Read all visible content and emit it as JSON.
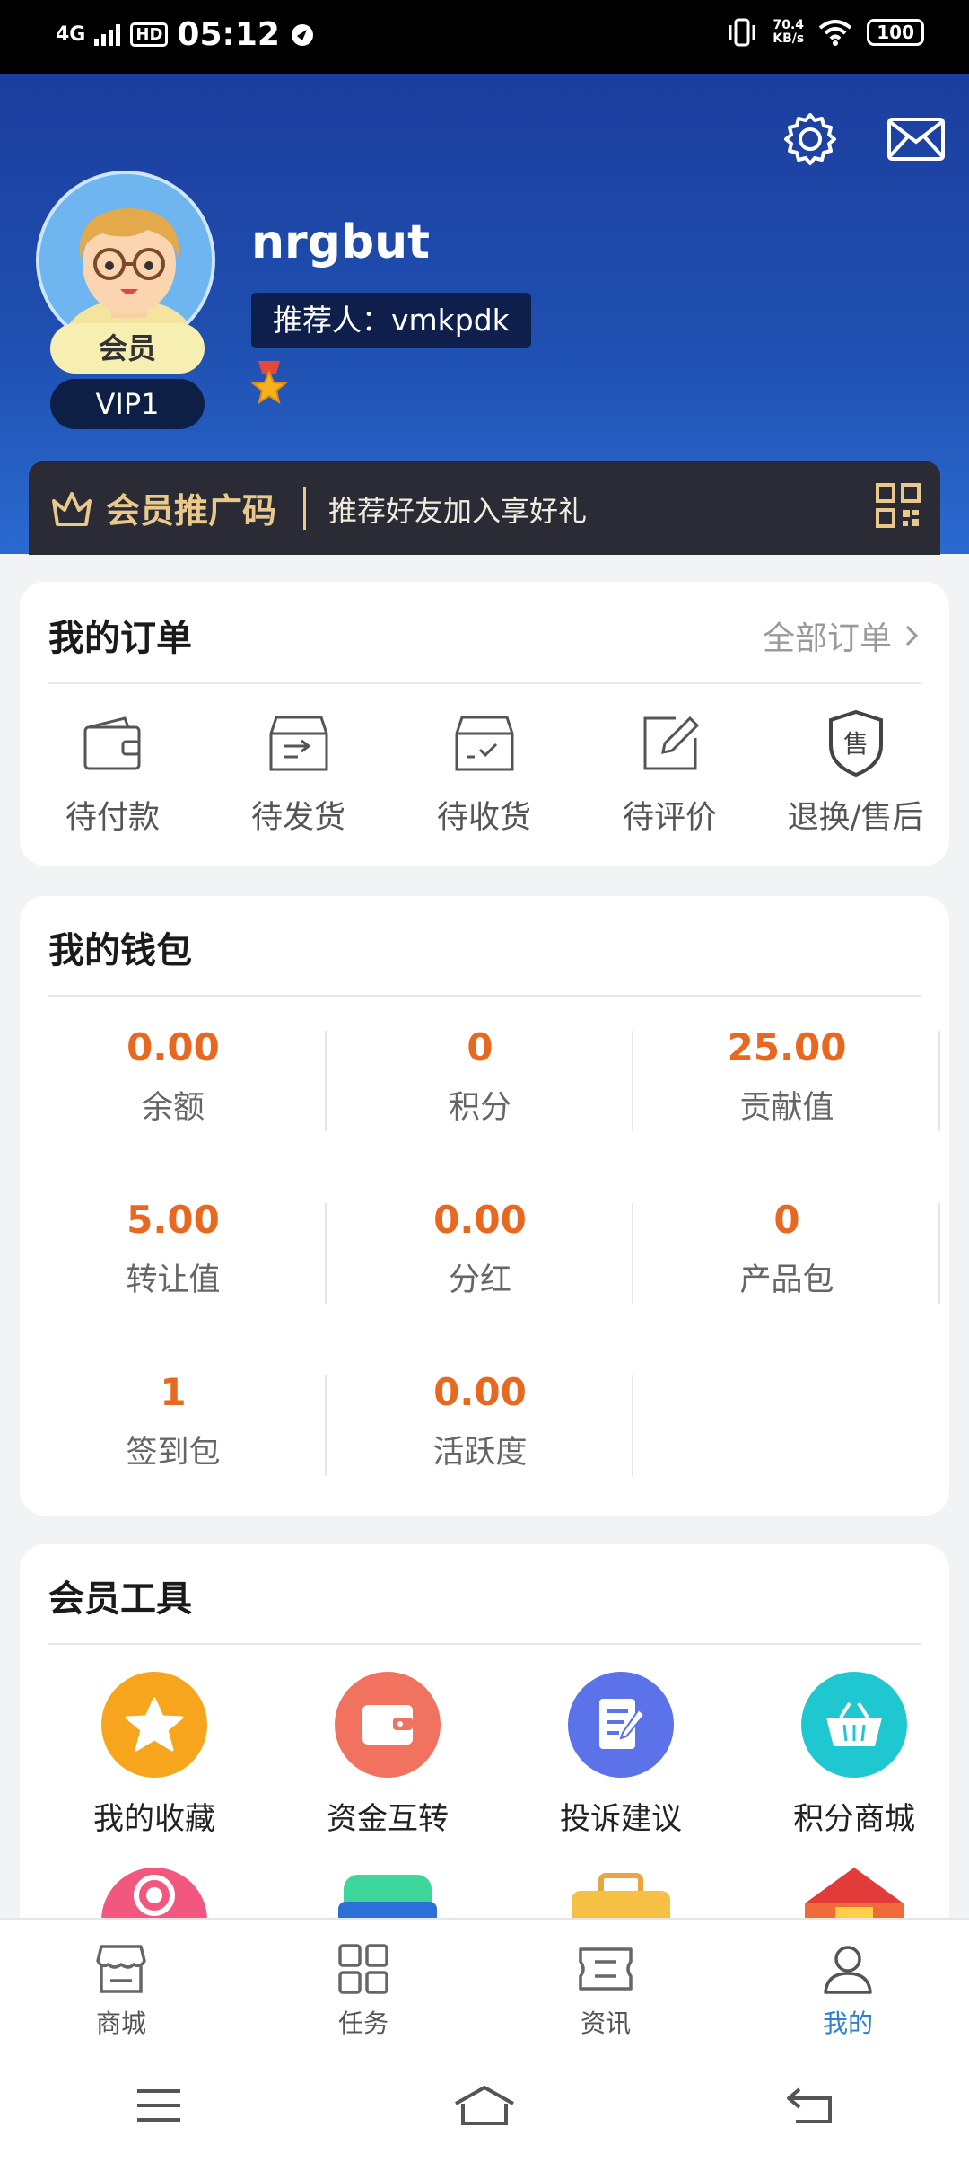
{
  "status_bar": {
    "network": "4G",
    "hd": "HD",
    "time": "05:12",
    "speed_value": "70.4",
    "speed_unit": "KB/s",
    "battery": "100"
  },
  "profile": {
    "username": "nrgbut",
    "referrer": "推荐人：vmkpdk",
    "member_badge": "会员",
    "vip_level": "VIP1"
  },
  "promo": {
    "title": "会员推广码",
    "subtitle": "推荐好友加入享好礼"
  },
  "orders": {
    "title": "我的订单",
    "all_label": "全部订单",
    "items": [
      {
        "label": "待付款",
        "icon": "wallet-icon"
      },
      {
        "label": "待发货",
        "icon": "shipping-box-icon"
      },
      {
        "label": "待收货",
        "icon": "received-box-icon"
      },
      {
        "label": "待评价",
        "icon": "edit-review-icon"
      },
      {
        "label": "退换/售后",
        "icon": "after-sales-shield-icon"
      }
    ]
  },
  "wallet": {
    "title": "我的钱包",
    "items": [
      {
        "value": "0.00",
        "label": "余额"
      },
      {
        "value": "0",
        "label": "积分"
      },
      {
        "value": "25.00",
        "label": "贡献值"
      },
      {
        "value": "5.00",
        "label": "转让值"
      },
      {
        "value": "0.00",
        "label": "分红"
      },
      {
        "value": "0",
        "label": "产品包"
      },
      {
        "value": "1",
        "label": "签到包"
      },
      {
        "value": "0.00",
        "label": "活跃度"
      }
    ]
  },
  "tools": {
    "title": "会员工具",
    "items": [
      {
        "label": "我的收藏",
        "icon": "star-icon",
        "color": "#f7a51c"
      },
      {
        "label": "资金互转",
        "icon": "wallet-transfer-icon",
        "color": "#f0725f"
      },
      {
        "label": "投诉建议",
        "icon": "document-edit-icon",
        "color": "#5b72e8"
      },
      {
        "label": "积分商城",
        "icon": "basket-icon",
        "color": "#1fc7d0"
      }
    ]
  },
  "bottom_nav": [
    {
      "label": "商城",
      "icon": "store-icon",
      "active": false
    },
    {
      "label": "任务",
      "icon": "grid-icon",
      "active": false
    },
    {
      "label": "资讯",
      "icon": "news-icon",
      "active": false
    },
    {
      "label": "我的",
      "icon": "user-icon",
      "active": true
    }
  ],
  "colors": {
    "header_top": "#1c3e9e",
    "accent_orange": "#e9681f",
    "promo_gold": "#e9c98b",
    "active_nav": "#2f7fd1"
  }
}
